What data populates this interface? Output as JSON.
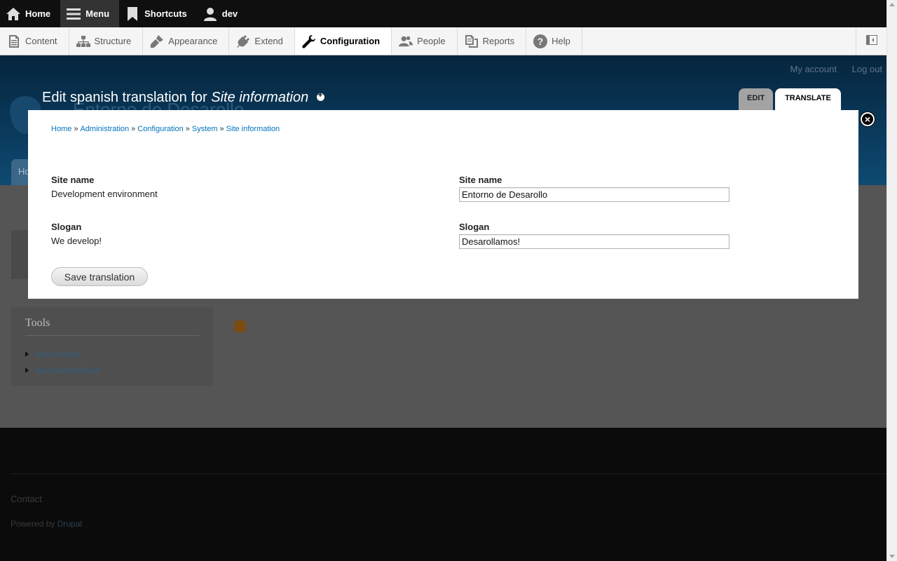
{
  "toolbar": {
    "items": [
      {
        "label": "Home",
        "icon": "home-icon"
      },
      {
        "label": "Menu",
        "icon": "menu-icon"
      },
      {
        "label": "Shortcuts",
        "icon": "bookmark-icon"
      },
      {
        "label": "dev",
        "icon": "user-icon"
      }
    ]
  },
  "tray": {
    "items": [
      {
        "label": "Content",
        "icon": "document-icon"
      },
      {
        "label": "Structure",
        "icon": "sitemap-icon"
      },
      {
        "label": "Appearance",
        "icon": "paintbrush-icon"
      },
      {
        "label": "Extend",
        "icon": "plug-icon"
      },
      {
        "label": "Configuration",
        "icon": "wrench-icon"
      },
      {
        "label": "People",
        "icon": "people-icon"
      },
      {
        "label": "Reports",
        "icon": "reports-icon"
      },
      {
        "label": "Help",
        "icon": "help-icon"
      }
    ]
  },
  "header": {
    "user_links": [
      "My account",
      "Log out"
    ],
    "site_name": "Entorno de Desarollo",
    "tab_home": "Ho"
  },
  "overlay": {
    "title_prefix": "Edit spanish translation for",
    "title_subject": "Site information",
    "tabs": [
      "EDIT",
      "TRANSLATE"
    ]
  },
  "breadcrumb": [
    "Home",
    "Administration",
    "Configuration",
    "System",
    "Site information"
  ],
  "form": {
    "source_site_name_label": "Site name",
    "source_site_name_value": "Development environment",
    "source_slogan_label": "Slogan",
    "source_slogan_value": "We develop!",
    "target_site_name_label": "Site name",
    "target_site_name_value": "Entorno de Desarollo",
    "target_slogan_label": "Slogan",
    "target_slogan_value": "Desarollamos!",
    "save_label": "Save translation"
  },
  "sidebar": {
    "tools_title": "Tools",
    "links": [
      "Add content",
      "Add custom block"
    ]
  },
  "footer": {
    "contact": "Contact",
    "powered_prefix": "Powered by",
    "powered_link": "Drupal"
  }
}
